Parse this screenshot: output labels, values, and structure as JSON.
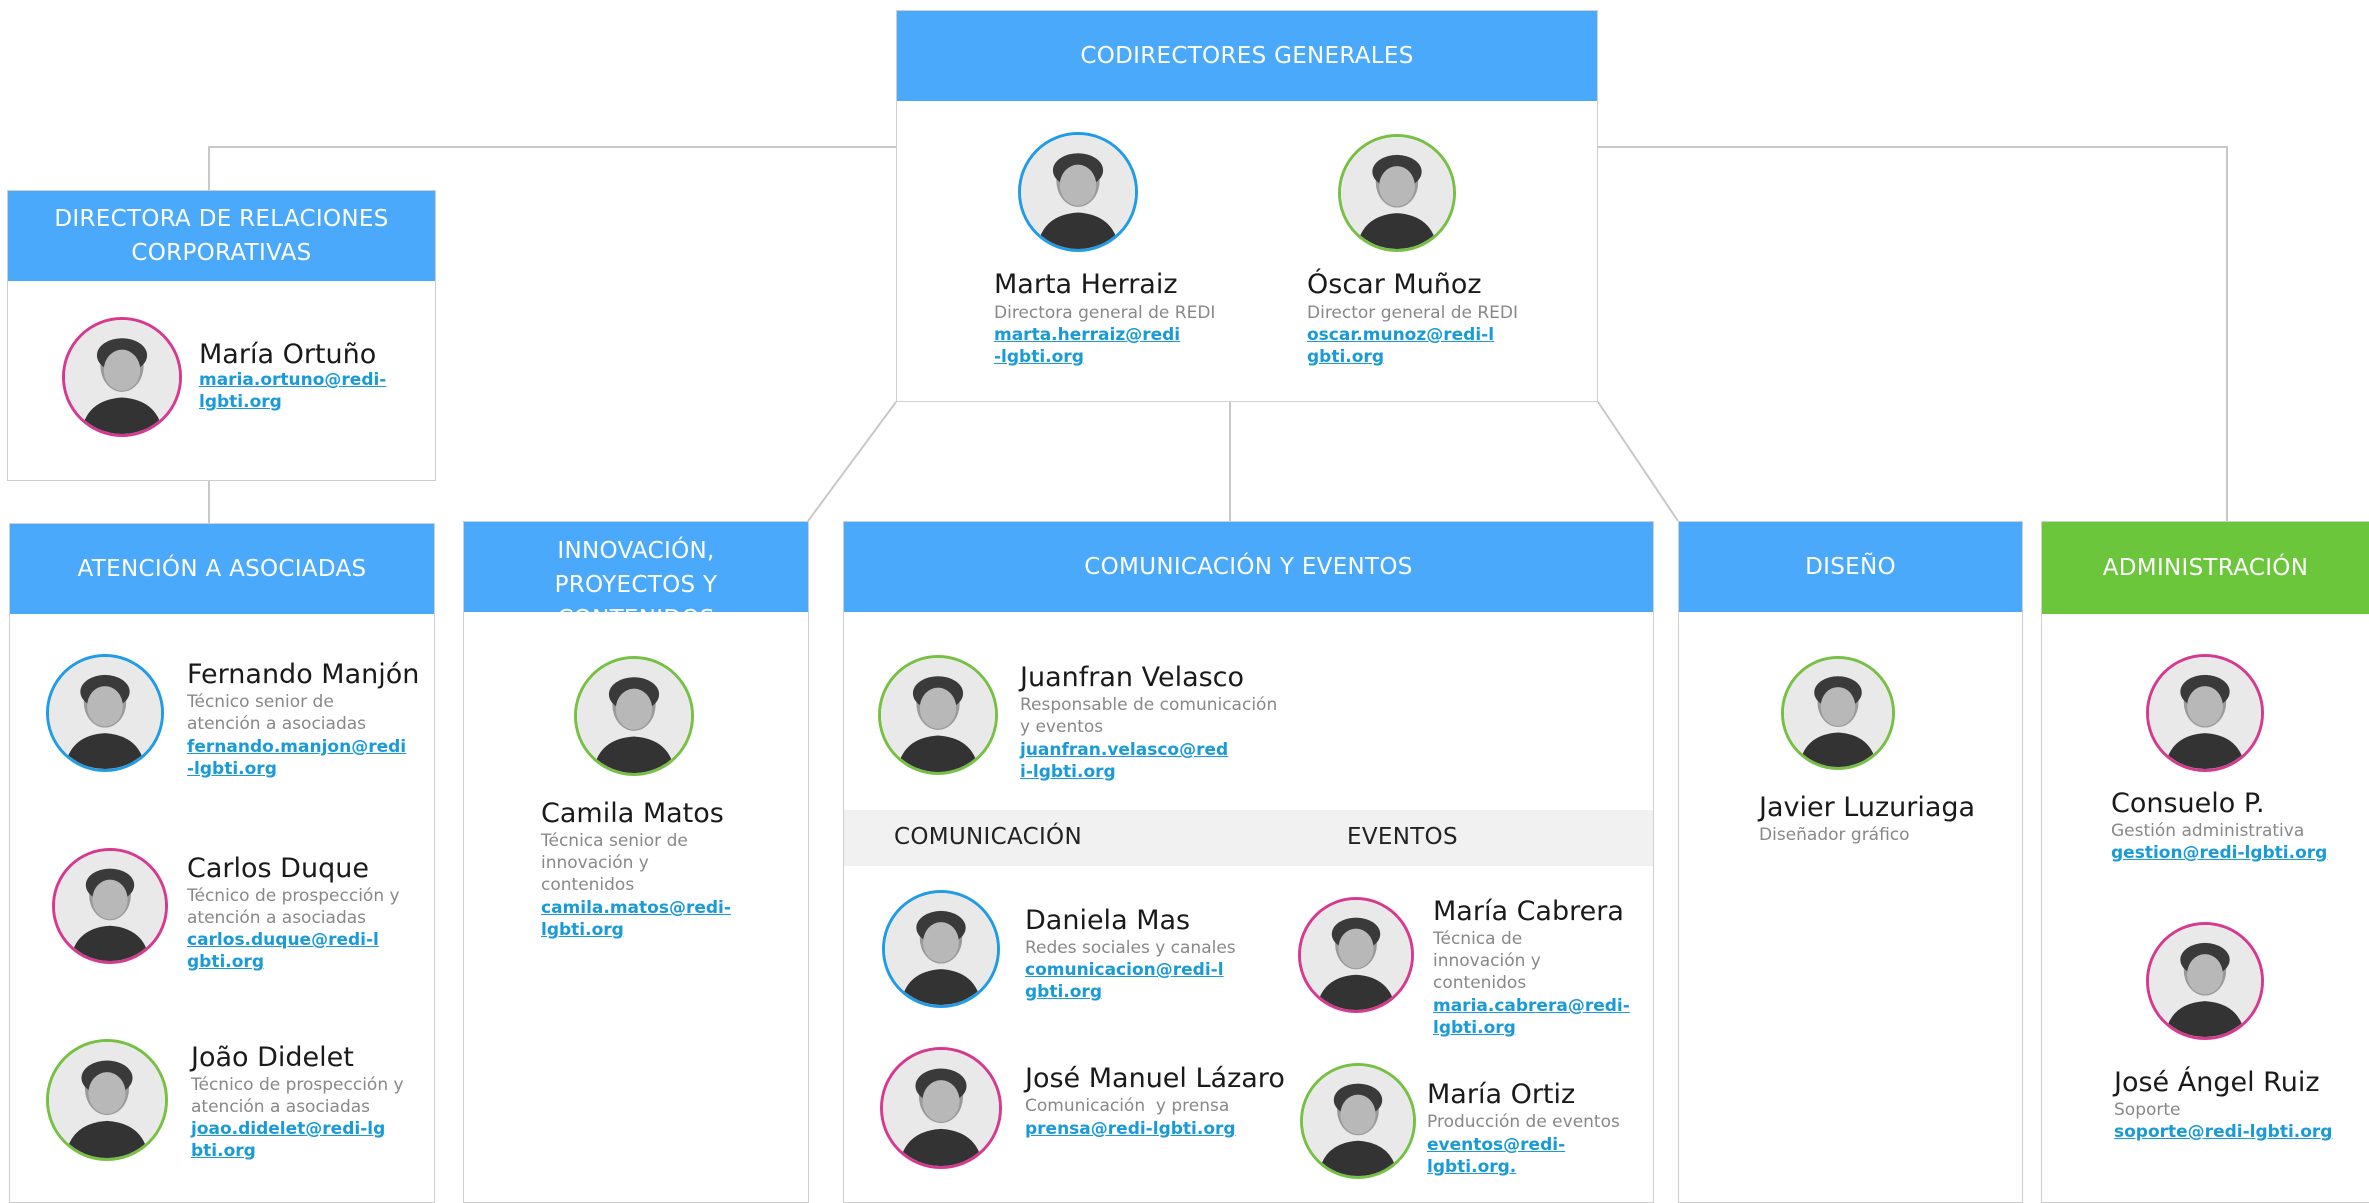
{
  "headers": {
    "codirectores": "CODIRECTORES GENERALES",
    "relaciones": "DIRECTORA DE RELACIONES CORPORATIVAS",
    "atencion": "ATENCIÓN A ASOCIADAS",
    "innovacion": "INNOVACIÓN, PROYECTOS Y CONTENIDOS",
    "comunicacion_eventos": "COMUNICACIÓN Y EVENTOS",
    "diseno": "DISEÑO",
    "administracion": "ADMINISTRACIÓN",
    "comunicacion": "COMUNICACIÓN",
    "eventos": "EVENTOS"
  },
  "people": {
    "marta": {
      "name": "Marta Herraiz",
      "role": "Directora general de REDI",
      "email": "marta.herraiz@redi-lgbti.org"
    },
    "oscar": {
      "name": "Óscar Muñoz",
      "role": "Director general de REDI",
      "email": "oscar.munoz@redi-lgbti.org"
    },
    "maria_ortuno": {
      "name": "María Ortuño",
      "email": "maria.ortuno@redi-lgbti.org"
    },
    "fernando": {
      "name": "Fernando Manjón",
      "role": "Técnico senior de atención a asociadas",
      "email": "fernando.manjon@redi-lgbti.org"
    },
    "carlos": {
      "name": "Carlos Duque",
      "role": "Técnico de prospección y atención a asociadas",
      "email": "carlos.duque@redi-lgbti.org"
    },
    "joao": {
      "name": "João Didelet",
      "role": "Técnico de prospección y atención a asociadas",
      "email": "joao.didelet@redi-lgbti.org"
    },
    "camila": {
      "name": "Camila Matos",
      "role": "Técnica senior de innovación y contenidos",
      "email": "camila.matos@redi-lgbti.org"
    },
    "juanfran": {
      "name": "Juanfran Velasco",
      "role": "Responsable de comunicación y eventos",
      "email": "juanfran.velasco@redi-lgbti.org"
    },
    "daniela": {
      "name": "Daniela Mas",
      "role": "Redes sociales y canales",
      "email": "comunicacion@redi-lgbti.org"
    },
    "jose_manuel": {
      "name": "José Manuel Lázaro",
      "role": "Comunicación  y prensa",
      "email": "prensa@redi-lgbti.org"
    },
    "maria_cabrera": {
      "name": "María Cabrera",
      "role": "Técnica de innovación y contenidos",
      "email": "maria.cabrera@redi-lgbti.org"
    },
    "maria_ortiz": {
      "name": "María Ortiz",
      "role": "Producción de eventos",
      "email": "eventos@redi-lgbti.org."
    },
    "javier": {
      "name": "Javier Luzuriaga",
      "role": "Diseñador gráfico"
    },
    "consuelo": {
      "name": "Consuelo P.",
      "role": "Gestión administrativa",
      "email": "gestion@redi-lgbti.org"
    },
    "jose_angel": {
      "name": "José Ángel Ruiz",
      "role": "Soporte",
      "email": "soporte@redi-lgbti.org"
    }
  },
  "colors": {
    "header_blue": "#4aa9fb",
    "header_green": "#6cc63c",
    "ring_blue": "#1f9be8",
    "ring_green": "#76c043",
    "ring_pink": "#d6398f",
    "link": "#1a9ad6"
  }
}
